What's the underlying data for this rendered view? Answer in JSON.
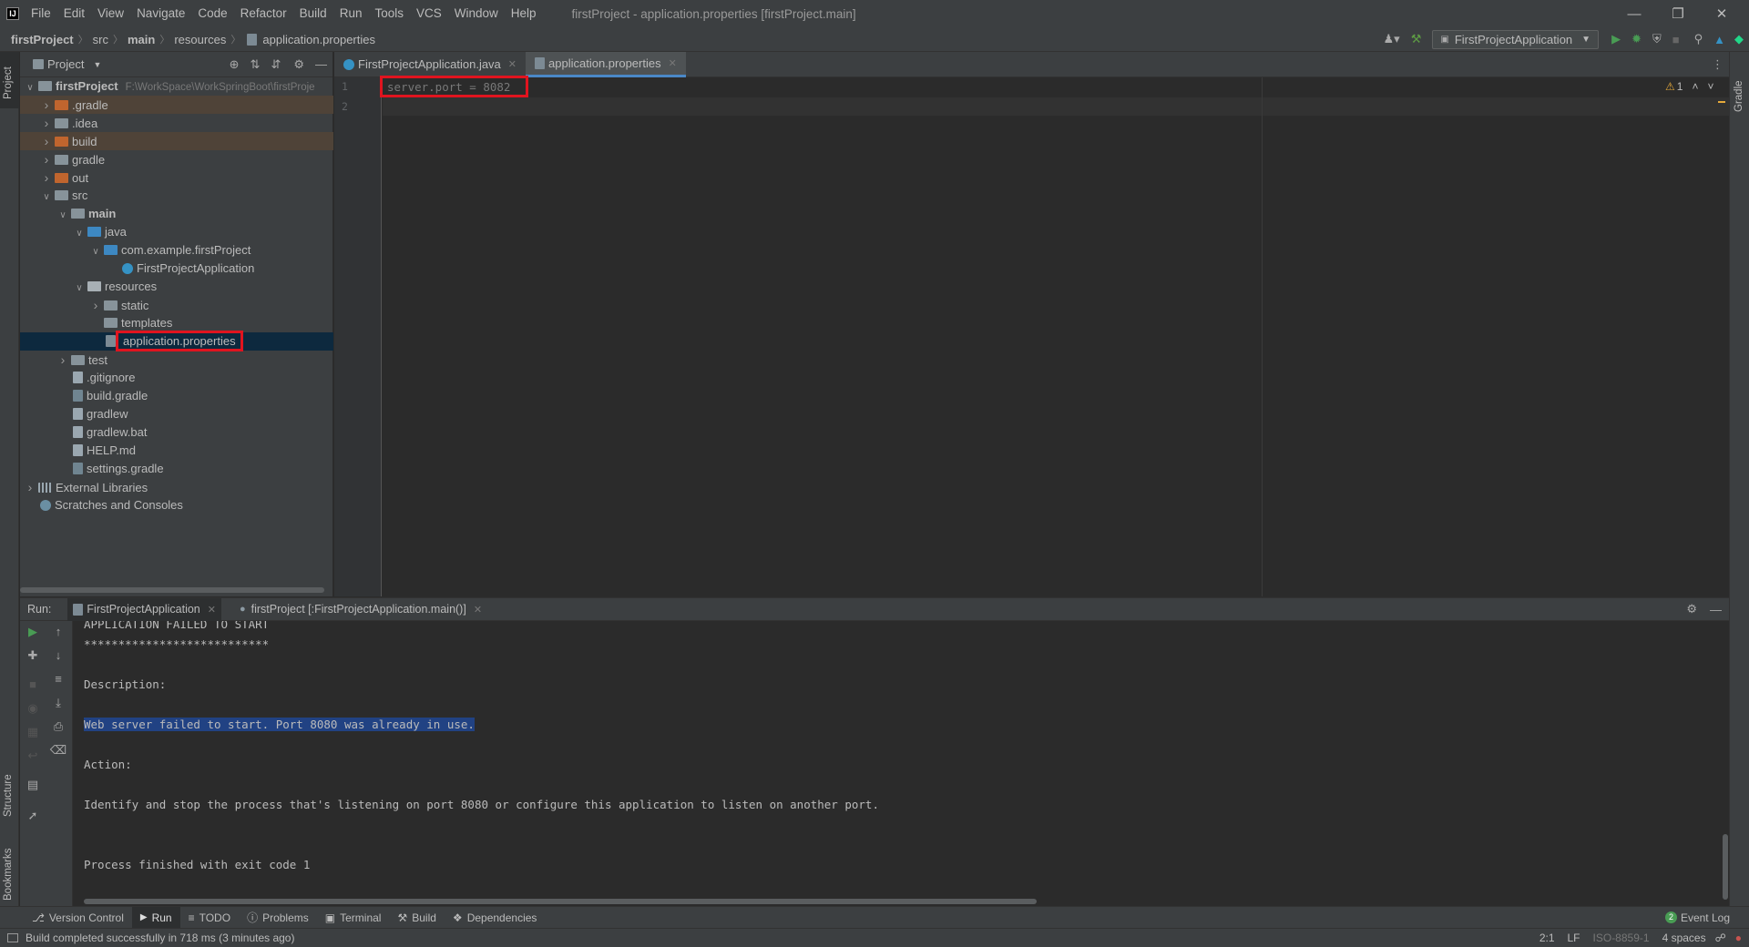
{
  "menubar": {
    "items": [
      "File",
      "Edit",
      "View",
      "Navigate",
      "Code",
      "Refactor",
      "Build",
      "Run",
      "Tools",
      "VCS",
      "Window",
      "Help"
    ],
    "window_title": "firstProject - application.properties [firstProject.main]"
  },
  "breadcrumb": [
    "firstProject",
    "src",
    "main",
    "resources",
    "application.properties"
  ],
  "run_config": "FirstProjectApplication",
  "left_strip": {
    "project": "Project",
    "structure": "Structure",
    "bookmarks": "Bookmarks"
  },
  "right_strip": {
    "gradle": "Gradle"
  },
  "project_panel": {
    "title": "Project",
    "root_path": "F:\\WorkSpace\\WorkSpringBoot\\firstProje",
    "tree": [
      {
        "label": "firstProject",
        "depth": 0,
        "arrow": "down",
        "icon": "module-folder",
        "bold": true
      },
      {
        "label": ".gradle",
        "depth": 1,
        "arrow": "right",
        "icon": "folder-excluded"
      },
      {
        "label": ".idea",
        "depth": 1,
        "arrow": "right",
        "icon": "folder"
      },
      {
        "label": "build",
        "depth": 1,
        "arrow": "right",
        "icon": "folder-excluded"
      },
      {
        "label": "gradle",
        "depth": 1,
        "arrow": "right",
        "icon": "folder"
      },
      {
        "label": "out",
        "depth": 1,
        "arrow": "right",
        "icon": "folder-excluded"
      },
      {
        "label": "src",
        "depth": 1,
        "arrow": "down",
        "icon": "folder"
      },
      {
        "label": "main",
        "depth": 2,
        "arrow": "down",
        "icon": "folder",
        "bold": true
      },
      {
        "label": "java",
        "depth": 3,
        "arrow": "down",
        "icon": "source-folder"
      },
      {
        "label": "com.example.firstProject",
        "depth": 4,
        "arrow": "down",
        "icon": "package"
      },
      {
        "label": "FirstProjectApplication",
        "depth": 5,
        "arrow": "",
        "icon": "class"
      },
      {
        "label": "resources",
        "depth": 3,
        "arrow": "down",
        "icon": "resources-folder"
      },
      {
        "label": "static",
        "depth": 4,
        "arrow": "right",
        "icon": "folder"
      },
      {
        "label": "templates",
        "depth": 4,
        "arrow": "",
        "icon": "folder"
      },
      {
        "label": "application.properties",
        "depth": 4,
        "arrow": "",
        "icon": "properties-file",
        "selected": true
      },
      {
        "label": "test",
        "depth": 2,
        "arrow": "right",
        "icon": "folder"
      },
      {
        "label": ".gitignore",
        "depth": 2,
        "arrow": "",
        "icon": "file"
      },
      {
        "label": "build.gradle",
        "depth": 2,
        "arrow": "",
        "icon": "gradle-file"
      },
      {
        "label": "gradlew",
        "depth": 2,
        "arrow": "",
        "icon": "file"
      },
      {
        "label": "gradlew.bat",
        "depth": 2,
        "arrow": "",
        "icon": "file"
      },
      {
        "label": "HELP.md",
        "depth": 2,
        "arrow": "",
        "icon": "markdown-file"
      },
      {
        "label": "settings.gradle",
        "depth": 2,
        "arrow": "",
        "icon": "gradle-file"
      },
      {
        "label": "External Libraries",
        "depth": 0,
        "arrow": "right",
        "icon": "library"
      },
      {
        "label": "Scratches and Consoles",
        "depth": 0,
        "arrow": "",
        "icon": "scratches"
      }
    ]
  },
  "editor": {
    "tabs": [
      {
        "label": "FirstProjectApplication.java",
        "active": false
      },
      {
        "label": "application.properties",
        "active": true
      }
    ],
    "line_numbers": [
      "1",
      "2"
    ],
    "lines": [
      "server.port = 8082",
      ""
    ],
    "warning_count": "1"
  },
  "run_panel": {
    "label": "Run:",
    "tabs": [
      "FirstProjectApplication",
      "firstProject [:FirstProjectApplication.main()]"
    ],
    "console": [
      "APPLICATION FAILED TO START",
      "***************************",
      "",
      "Description:",
      "",
      "Web server failed to start. Port 8080 was already in use.",
      "",
      "Action:",
      "",
      "Identify and stop the process that's listening on port 8080 or configure this application to listen on another port.",
      "",
      "",
      "Process finished with exit code 1"
    ]
  },
  "bottom_tabs": [
    "Version Control",
    "Run",
    "TODO",
    "Problems",
    "Terminal",
    "Build",
    "Dependencies"
  ],
  "event_log": "Event Log",
  "event_log_count": "2",
  "status": {
    "message": "Build completed successfully in 718 ms (3 minutes ago)",
    "position": "2:1",
    "line_sep": "LF",
    "encoding": "ISO-8859-1",
    "indent": "4 spaces"
  },
  "colors": {
    "highlight_box": "#e0141f",
    "selection": "#0d293e",
    "excluded": "#4f4338",
    "accent": "#4a88c7"
  }
}
